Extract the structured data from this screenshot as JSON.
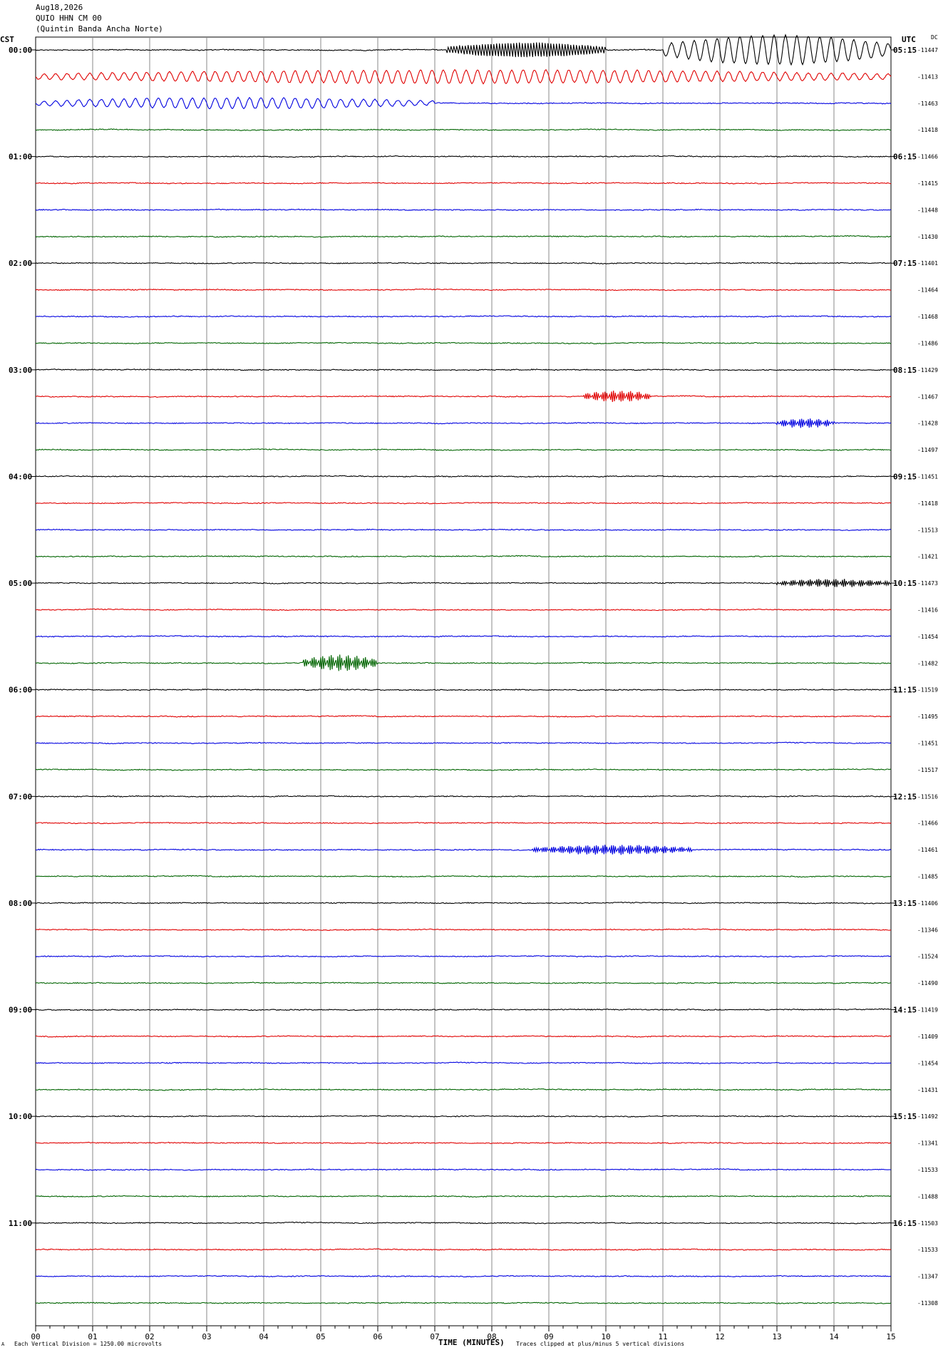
{
  "header": {
    "date": "Aug18,2026",
    "station": "QUIO HHN CM 00",
    "location": "(Quintin Banda Ancha Norte)"
  },
  "left_axis_label": "CST",
  "right_axis_label": "UTC",
  "dc_label": "DC",
  "footer": {
    "scale_note": "Each Vertical Division = 1250.00 microvolts",
    "clip_note": "Traces clipped at plus/minus 5 vertical divisions",
    "corner_mark": "A"
  },
  "chart_data": {
    "type": "line",
    "subtype": "helicorder",
    "xlabel": "TIME (MINUTES)",
    "xlim": [
      0,
      15
    ],
    "x_ticks": [
      "00",
      "01",
      "02",
      "03",
      "04",
      "05",
      "06",
      "07",
      "08",
      "09",
      "10",
      "11",
      "12",
      "13",
      "14",
      "15"
    ],
    "colors": [
      "#000000",
      "#e00000",
      "#0000e0",
      "#006400"
    ],
    "cst_labels": [
      "00:00",
      "01:00",
      "02:00",
      "03:00",
      "04:00",
      "05:00",
      "06:00",
      "07:00",
      "08:00",
      "09:00",
      "10:00",
      "11:00"
    ],
    "utc_labels": [
      "05:15",
      "06:15",
      "07:15",
      "08:15",
      "09:15",
      "10:15",
      "11:15",
      "12:15",
      "13:15",
      "14:15",
      "15:15",
      "16:15"
    ],
    "dc_offsets": [
      "-11447",
      "-11413",
      "-11463",
      "-11418",
      "-11466",
      "-11415",
      "-11448",
      "-11430",
      "-11401",
      "-11464",
      "-11468",
      "-11486",
      "-11429",
      "-11467",
      "-11428",
      "-11497",
      "-11451",
      "-11418",
      "-11513",
      "-11421",
      "-11473",
      "-11416",
      "-11454",
      "-11482",
      "-11519",
      "-11495",
      "-11451",
      "-11517",
      "-11516",
      "-11466",
      "-11461",
      "-11485",
      "-11406",
      "-11346",
      "-11524",
      "-11490",
      "-11419",
      "-11409",
      "-11454",
      "-11431",
      "-11492",
      "-11341",
      "-11533",
      "-11488",
      "-11503",
      "-11533",
      "-11347",
      "-11308"
    ],
    "events": [
      {
        "row": 0,
        "start_min": 7.2,
        "end_min": 10.0,
        "amplitude": 0.3,
        "period": 0.05
      },
      {
        "row": 0,
        "start_min": 11.0,
        "end_min": 15.0,
        "amplitude": 0.55,
        "period": 0.2
      },
      {
        "row": 1,
        "start_min": 0.0,
        "end_min": 15.0,
        "amplitude": 0.25,
        "period": 0.2
      },
      {
        "row": 2,
        "start_min": 0.0,
        "end_min": 7.0,
        "amplitude": 0.2,
        "period": 0.2
      },
      {
        "row": 13,
        "start_min": 9.6,
        "end_min": 10.8,
        "amplitude": 0.22,
        "period": 0.03
      },
      {
        "row": 14,
        "start_min": 13.0,
        "end_min": 14.0,
        "amplitude": 0.18,
        "period": 0.03
      },
      {
        "row": 20,
        "start_min": 13.0,
        "end_min": 15.0,
        "amplitude": 0.15,
        "period": 0.03
      },
      {
        "row": 23,
        "start_min": 4.7,
        "end_min": 6.0,
        "amplitude": 0.3,
        "period": 0.03
      },
      {
        "row": 30,
        "start_min": 8.7,
        "end_min": 11.5,
        "amplitude": 0.18,
        "period": 0.03
      }
    ]
  }
}
